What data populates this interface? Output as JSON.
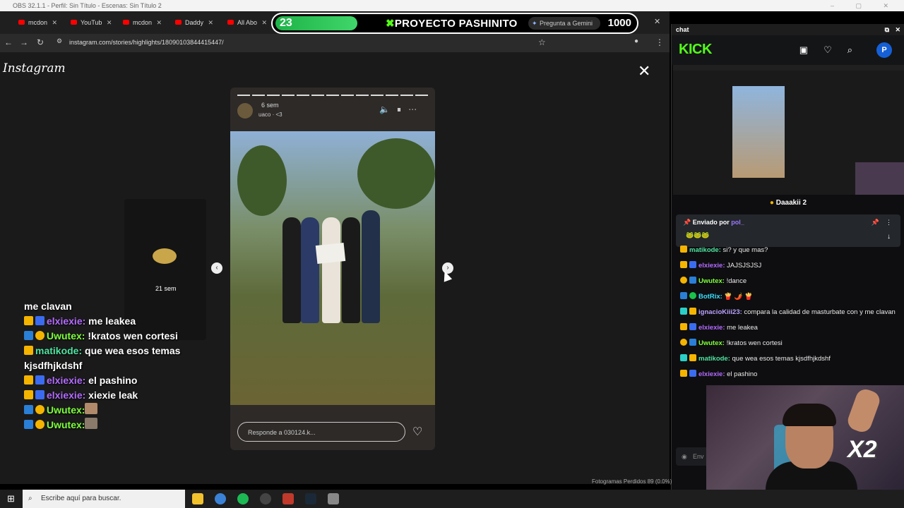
{
  "window": {
    "title": "OBS 32.1.1 - Perfil: Sin Título - Escenas: Sin Título 2"
  },
  "browser": {
    "tabs": [
      {
        "label": "mcdon"
      },
      {
        "label": "YouTub"
      },
      {
        "label": "mcdon"
      },
      {
        "label": "Daddy"
      },
      {
        "label": "All Abo"
      }
    ],
    "url": "instagram.com/stories/highlights/18090103844415447/"
  },
  "overlay": {
    "counter": "23",
    "title": "PROYECTO PASHINITO",
    "gemini_label": "Pregunta a Gemini",
    "goal": "1000"
  },
  "instagram": {
    "logo": "Instagram",
    "story": {
      "time": "6 sem",
      "subtitle": "uaco · <3",
      "reply_placeholder": "Responde a 030124.k..."
    },
    "side_story_time": "21 sem"
  },
  "left_chat": [
    {
      "user": "",
      "text": "me clavan",
      "user_color": "#ffffff",
      "badge": ""
    },
    {
      "user": "elxiexie:",
      "text": " me leakea",
      "user_color": "#b36bff",
      "badge": "#f5b400"
    },
    {
      "user": "Uwutex:",
      "text": " !kratos wen cortesi",
      "user_color": "#7dff3a",
      "badge": "#2a7fd6"
    },
    {
      "user": "matikode:",
      "text": " que wea esos temas kjsdfhjkdshf",
      "user_color": "#4fe3a0",
      "badge": "#f5b400"
    },
    {
      "user": "elxiexie:",
      "text": " el pashino",
      "user_color": "#b36bff",
      "badge": "#f5b400"
    },
    {
      "user": "elxiexie:",
      "text": " xiexie leak",
      "user_color": "#b36bff",
      "badge": "#f5b400"
    },
    {
      "user": "Uwutex:",
      "text": "",
      "user_color": "#7dff3a",
      "badge": "#2a7fd6"
    },
    {
      "user": "Uwutex:",
      "text": "",
      "user_color": "#7dff3a",
      "badge": "#2a7fd6"
    }
  ],
  "chat_panel": {
    "title": "chat",
    "logo": "KICK",
    "avatar_letter": "P",
    "sub_banner": "Daaakii 2",
    "pinned_prefix": "Enviado por",
    "pinned_user": "pol_",
    "messages": [
      {
        "user": "matikode:",
        "text": " si? y que mas?",
        "color": "#4fe3a0"
      },
      {
        "user": "elxiexie:",
        "text": " JAJSJSJSJ",
        "color": "#b36bff"
      },
      {
        "user": "Uwutex:",
        "text": " !dance",
        "color": "#7dff3a"
      },
      {
        "user": "BotRix:",
        "text": " 🍟 🌶️ 🍟",
        "color": "#39e0ff"
      },
      {
        "user": "ignacioKiii23:",
        "text": " compara la calidad de masturbate con y me clavan",
        "color": "#b9a3ff"
      },
      {
        "user": "elxiexie:",
        "text": " me leakea",
        "color": "#b36bff"
      },
      {
        "user": "Uwutex:",
        "text": " !kratos wen cortesi",
        "color": "#7dff3a"
      },
      {
        "user": "matikode:",
        "text": " que wea esos temas kjsdfhjkdshf",
        "color": "#4fe3a0"
      },
      {
        "user": "elxiexie:",
        "text": " el pashino",
        "color": "#b36bff"
      }
    ],
    "input_placeholder": "Env"
  },
  "webcam": {
    "multiplier": "X2"
  },
  "taskbar": {
    "search_placeholder": "Escribe aquí para buscar.",
    "status": "Fotogramas Perdidos 89 (0.0%)"
  }
}
